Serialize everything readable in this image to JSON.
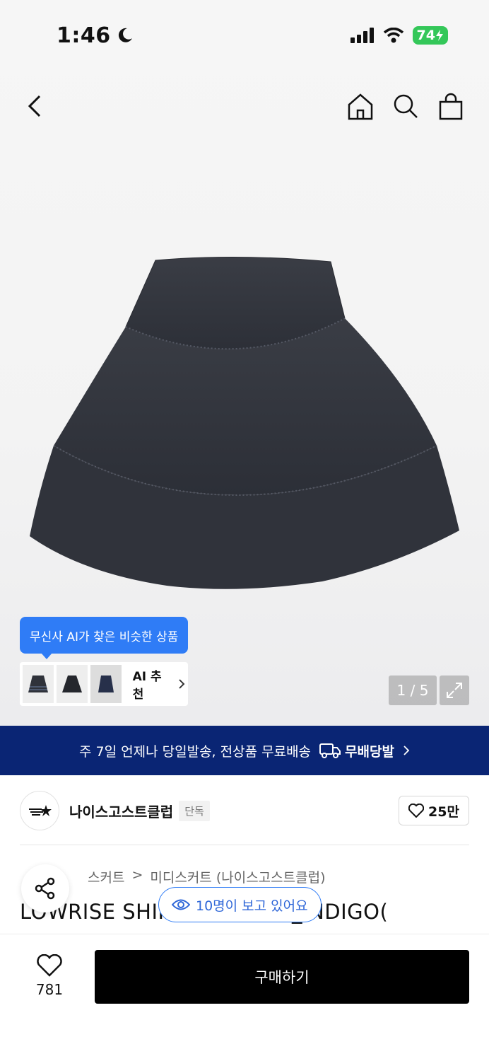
{
  "status": {
    "time": "1:46",
    "battery": "74"
  },
  "image": {
    "counter": "1 / 5"
  },
  "ai": {
    "tooltip": "무신사 AI가 찾은 비슷한 상품",
    "recommend_label": "AI 추천"
  },
  "banner": {
    "text": "주 7일 언제나 당일발송, 전상품 무료배송",
    "badge": "무배당발"
  },
  "brand": {
    "name": "나이스고스트클럽",
    "badge": "단독",
    "likes": "25만"
  },
  "breadcrumb": [
    "스커트",
    "미디스커트 (나이스고스트클럽)"
  ],
  "product": {
    "title": "LOWRISE SHIRRING SKIRT_INDIGO("
  },
  "viewing": {
    "text": "10명이 보고 있어요"
  },
  "bottom": {
    "wish_count": "781",
    "buy_label": "구매하기"
  },
  "colors": {
    "accent_blue": "#2f7cf6",
    "banner_navy": "#0a2574",
    "buy_black": "#000000"
  }
}
